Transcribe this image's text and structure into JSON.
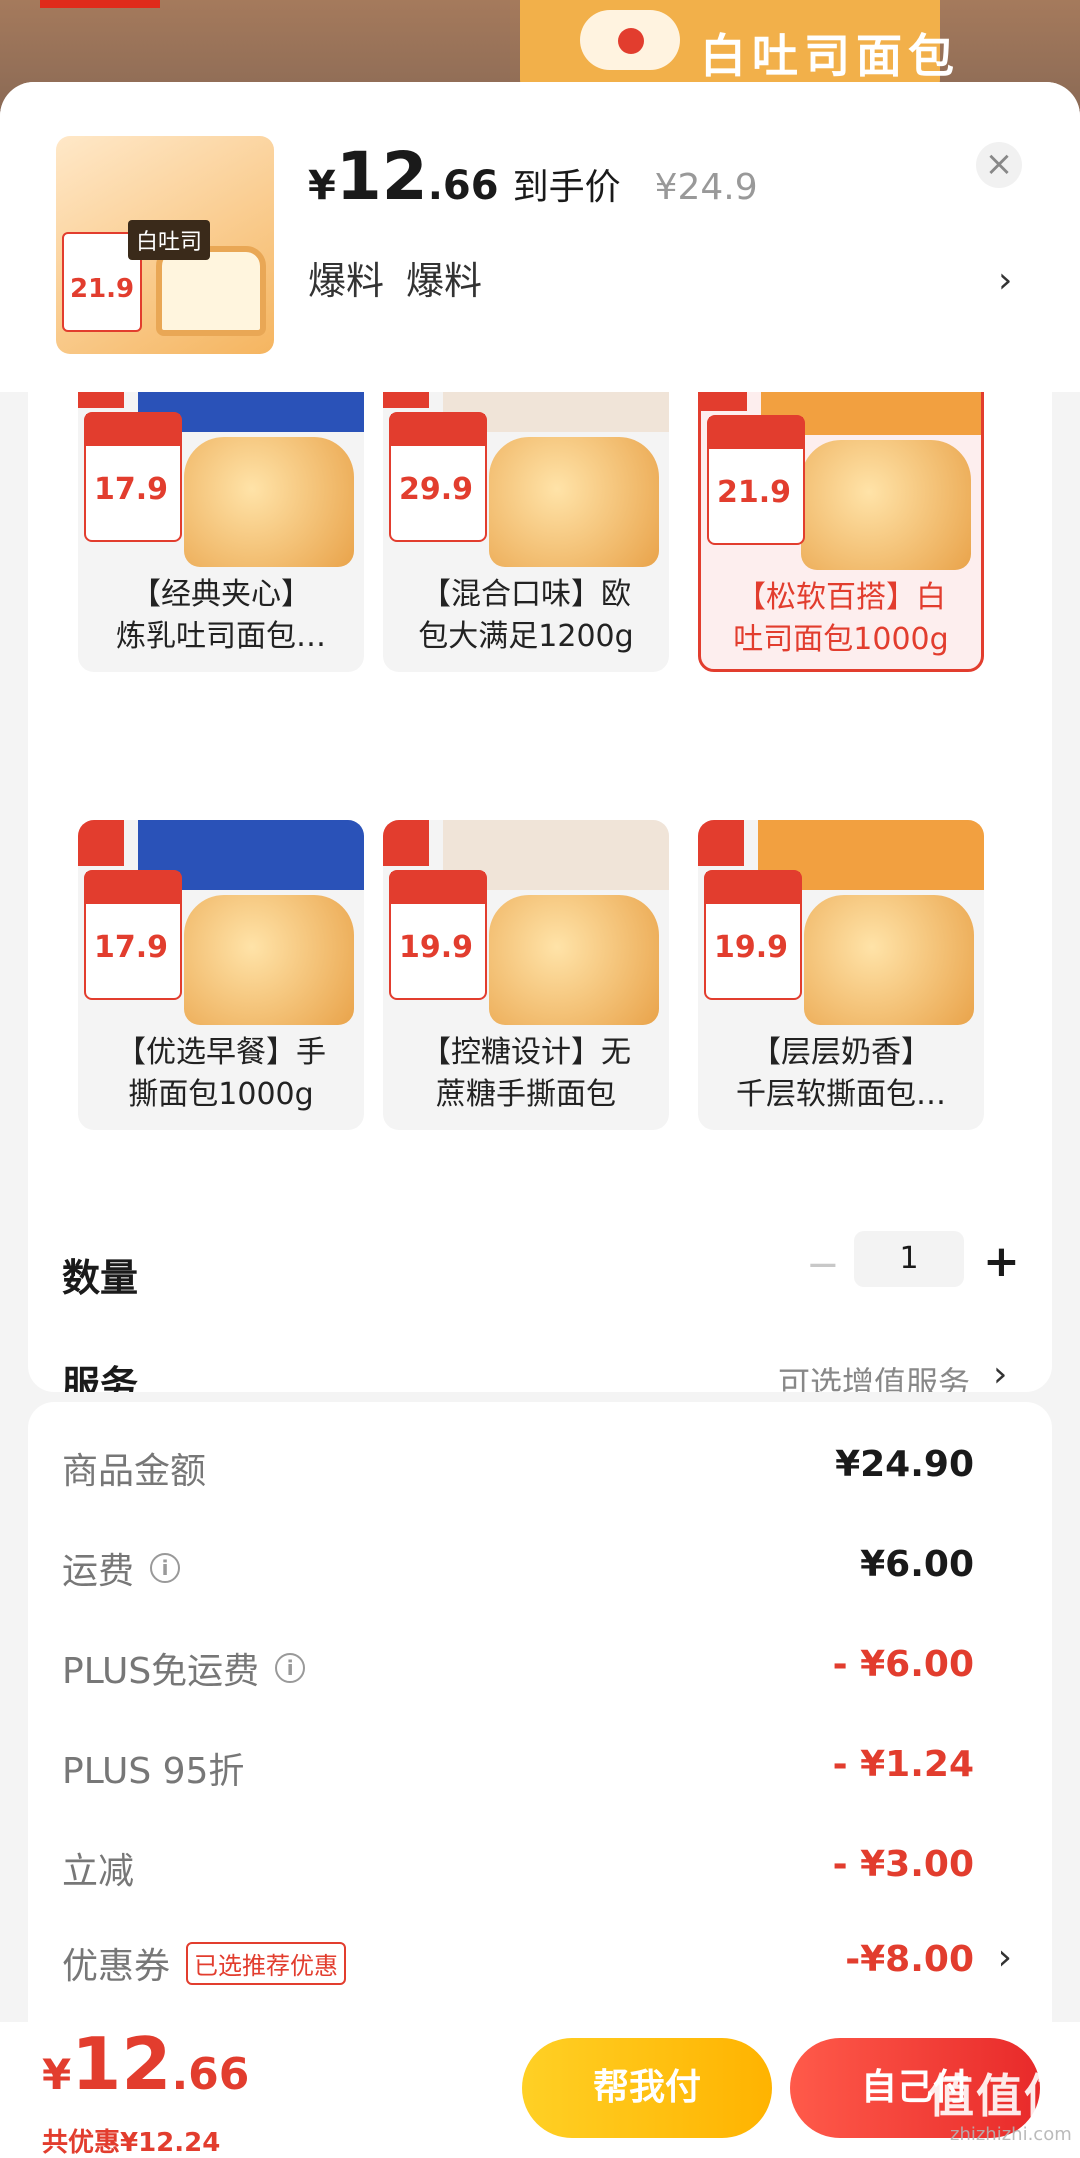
{
  "background": {
    "title": "白吐司面包"
  },
  "header": {
    "price_yen": "¥",
    "price_int": "12",
    "price_dec": ".66",
    "price_tag": "到手价",
    "orig_price": "¥24.9",
    "tags": [
      "爆料",
      "爆料"
    ],
    "thumb_label": "白吐司",
    "thumb_price": "21.9",
    "close_icon": "close-icon",
    "chevron_icon": "chevron-right-icon"
  },
  "variants": [
    {
      "line1": "【经典夹心】",
      "line2": "炼乳吐司面包…",
      "price": "17.9",
      "selected": false
    },
    {
      "line1": "【混合口味】欧",
      "line2": "包大满足1200g",
      "price": "29.9",
      "selected": false
    },
    {
      "line1": "【松软百搭】白",
      "line2": "吐司面包1000g",
      "price": "21.9",
      "selected": true
    },
    {
      "line1": "【优选早餐】手",
      "line2": "撕面包1000g",
      "price": "17.9",
      "selected": false
    },
    {
      "line1": "【控糖设计】无",
      "line2": "蔗糖手撕面包",
      "price": "19.9",
      "selected": false
    },
    {
      "line1": "【层层奶香】",
      "line2": "千层软撕面包…",
      "price": "19.9",
      "selected": false
    }
  ],
  "quantity": {
    "label": "数量",
    "value": "1",
    "minus": "−",
    "plus": "+"
  },
  "service": {
    "label": "服务",
    "option": "可选增值服务",
    "chevron": "›"
  },
  "summary": {
    "rows": [
      {
        "label": "商品金额",
        "value": "¥24.90",
        "red": false
      },
      {
        "label": "运费",
        "value": "¥6.00",
        "red": false,
        "info": true
      },
      {
        "label": "PLUS免运费",
        "value": "- ¥6.00",
        "red": true,
        "info": true
      },
      {
        "label": "PLUS 95折",
        "value": "- ¥1.24",
        "red": true
      },
      {
        "label": "立减",
        "value": "- ¥3.00",
        "red": true
      },
      {
        "label": "优惠券",
        "value": "-¥8.00",
        "red": true,
        "tag": "已选推荐优惠"
      }
    ]
  },
  "footer": {
    "yen": "¥",
    "int": "12",
    "dec": ".66",
    "saved": "共优惠¥12.24",
    "help_button": "帮我付",
    "self_button": "自己付"
  },
  "watermark": {
    "text": "值值值",
    "sub": "zhizhizhi.com"
  },
  "colors": {
    "accent": "#e23d2e",
    "help_button": "#ffc107",
    "self_button": "#ef3b34"
  }
}
